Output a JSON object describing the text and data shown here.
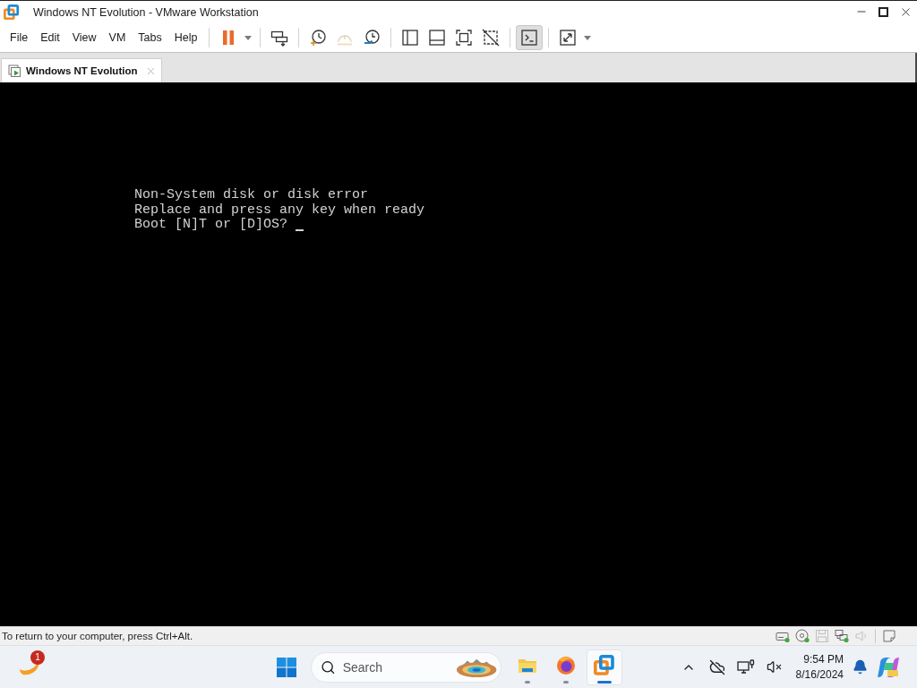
{
  "window": {
    "title": "Windows NT Evolution - VMware Workstation"
  },
  "menu": [
    {
      "label": "File"
    },
    {
      "label": "Edit"
    },
    {
      "label": "View"
    },
    {
      "label": "VM"
    },
    {
      "label": "Tabs"
    },
    {
      "label": "Help"
    }
  ],
  "toolbar": [
    {
      "buttons": [
        {
          "kind": "pause",
          "dropdown": true,
          "selected": false,
          "disabled": false
        }
      ]
    },
    {
      "buttons": [
        {
          "kind": "send-keys",
          "dropdown": false,
          "selected": false,
          "disabled": false
        }
      ]
    },
    {
      "buttons": [
        {
          "kind": "snapshot-take",
          "dropdown": false,
          "selected": false,
          "disabled": false
        },
        {
          "kind": "snapshot-revert",
          "dropdown": false,
          "selected": false,
          "disabled": true
        },
        {
          "kind": "snapshot-manager",
          "dropdown": false,
          "selected": false,
          "disabled": false
        }
      ]
    },
    {
      "buttons": [
        {
          "kind": "library",
          "dropdown": false,
          "selected": false,
          "disabled": false
        },
        {
          "kind": "thumbnail-bar",
          "dropdown": false,
          "selected": false,
          "disabled": false
        },
        {
          "kind": "full-screen",
          "dropdown": false,
          "selected": false,
          "disabled": false
        },
        {
          "kind": "unity",
          "dropdown": false,
          "selected": false,
          "disabled": false
        }
      ]
    },
    {
      "buttons": [
        {
          "kind": "console-view",
          "dropdown": false,
          "selected": true,
          "disabled": false
        }
      ]
    },
    {
      "buttons": [
        {
          "kind": "stretch",
          "dropdown": true,
          "selected": false,
          "disabled": false
        }
      ]
    }
  ],
  "tabs": [
    {
      "label": "Windows NT Evolution",
      "selected": true
    }
  ],
  "console": {
    "lines": [
      "Non-System disk or disk error",
      "Replace and press any key when ready",
      "Boot [N]T or [D]OS?"
    ],
    "cursor": true
  },
  "status_bar": {
    "message": "To return to your computer, press Ctrl+Alt.",
    "devices": [
      {
        "kind": "hard-disk",
        "connected": true
      },
      {
        "kind": "cd-rom",
        "connected": true
      },
      {
        "kind": "floppy",
        "connected": false
      },
      {
        "kind": "network",
        "connected": true
      },
      {
        "kind": "sound",
        "connected": false
      }
    ]
  },
  "taskbar": {
    "widgets_badge": "1",
    "search": {
      "placeholder": "Search"
    },
    "apps": [
      {
        "kind": "file-explorer",
        "running": true,
        "selected": false
      },
      {
        "kind": "firefox",
        "running": true,
        "selected": false
      },
      {
        "kind": "vmware",
        "running": true,
        "selected": true
      }
    ],
    "clock": {
      "time": "9:54 PM",
      "date": "8/16/2024"
    }
  }
}
